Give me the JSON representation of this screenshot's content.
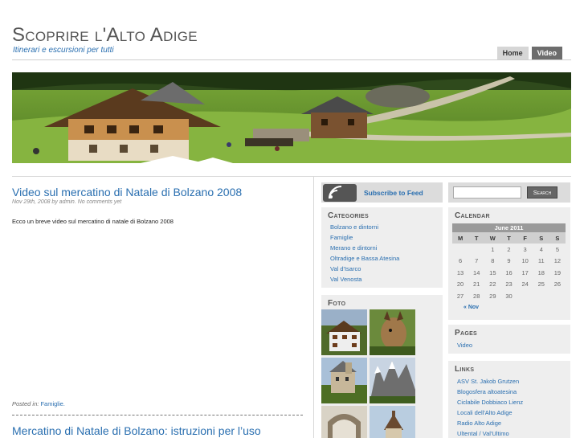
{
  "header": {
    "title": "Scoprire l'Alto Adige",
    "description": "Itinerari e escursioni per tutti"
  },
  "nav": {
    "home": "Home",
    "video": "Video"
  },
  "posts": [
    {
      "title": "Video sul mercatino di Natale di Bolzano 2008",
      "meta": "Nov 29th, 2008 by admin. No comments yet",
      "body": "Ecco un breve video sul mercatino di natale di Bolzano 2008",
      "posted_in_label": "Posted in:",
      "category": "Famiglie."
    },
    {
      "title": "Mercatino di Natale di Bolzano: istruzioni per l’uso"
    }
  ],
  "feed": {
    "label": "Subscribe to Feed"
  },
  "search": {
    "placeholder": "",
    "button": "Search"
  },
  "categories": {
    "title": "Categories",
    "items": [
      "Bolzano e dintorni",
      "Famiglie",
      "Merano e dintorni",
      "Oltradige e Bassa Atesina",
      "Val d'Isarco",
      "Val Venosta"
    ]
  },
  "foto": {
    "title": "Foto"
  },
  "calendar": {
    "title": "Calendar",
    "month": "June 2011",
    "weekdays": [
      "M",
      "T",
      "W",
      "T",
      "F",
      "S",
      "S"
    ],
    "weeks": [
      [
        "",
        "",
        "1",
        "2",
        "3",
        "4",
        "5"
      ],
      [
        "6",
        "7",
        "8",
        "9",
        "10",
        "11",
        "12"
      ],
      [
        "13",
        "14",
        "15",
        "16",
        "17",
        "18",
        "19"
      ],
      [
        "20",
        "21",
        "22",
        "23",
        "24",
        "25",
        "26"
      ],
      [
        "27",
        "28",
        "29",
        "30",
        "",
        "",
        ""
      ]
    ],
    "prev": "« Nov"
  },
  "pages": {
    "title": "Pages",
    "items": [
      "Video"
    ]
  },
  "links": {
    "title": "Links",
    "items": [
      "ASV St. Jakob Grutzen",
      "Blogosfera altoatesina",
      "Ciclabile Dobbiaco Lienz",
      "Locali dell'Alto Adige",
      "Radio Alto Adige",
      "Ultental / Val'Ultimo"
    ]
  },
  "colors": {
    "link": "#2a6fb0",
    "widget_bg": "#eeeeee",
    "nav_active": "#6d6d6d"
  }
}
